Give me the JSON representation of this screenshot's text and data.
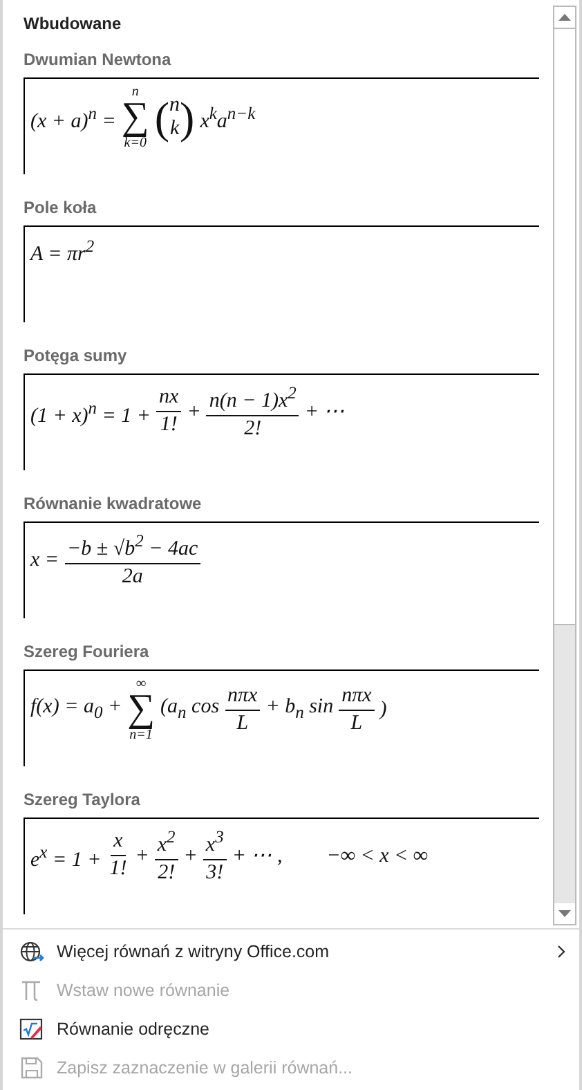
{
  "gallery": {
    "heading": "Wbudowane",
    "equations": [
      {
        "title": "Dwumian Newtona",
        "parts": [
          {
            "kind": "t",
            "text": "(x + a)$^{n}$ ="
          },
          {
            "kind": "sum",
            "symbol": "∑",
            "top": "n",
            "bottom": "k=0"
          },
          {
            "kind": "binom",
            "open": "(",
            "top": "n",
            "bottom": "k",
            "close": ")"
          },
          {
            "kind": "t",
            "text": "x$^{k}$a$^{n−k}$"
          }
        ]
      },
      {
        "title": "Pole koła",
        "parts": [
          {
            "kind": "t",
            "text": "A = πr$^{2}$"
          }
        ]
      },
      {
        "title": "Potęga sumy",
        "parts": [
          {
            "kind": "t",
            "text": "(1 + x)$^{n}$ = 1 +"
          },
          {
            "kind": "frac",
            "top": "nx",
            "bottom": "1!"
          },
          {
            "kind": "t",
            "text": "+"
          },
          {
            "kind": "frac",
            "top": "n(n − 1)x$^{2}$",
            "bottom": "2!"
          },
          {
            "kind": "t",
            "text": "+ ⋯"
          }
        ]
      },
      {
        "title": "Równanie kwadratowe",
        "parts": [
          {
            "kind": "t",
            "text": "x ="
          },
          {
            "kind": "frac",
            "top": "−b ± √b$^{2}$ − 4ac",
            "bottom": "2a"
          }
        ]
      },
      {
        "title": "Szereg Fouriera",
        "parts": [
          {
            "kind": "t",
            "text": "f(x) = a$_{0}$ +"
          },
          {
            "kind": "sum",
            "symbol": "∑",
            "top": "∞",
            "bottom": "n=1"
          },
          {
            "kind": "t",
            "text": "(a$_{n}$ cos"
          },
          {
            "kind": "frac",
            "top": "nπx",
            "bottom": "L"
          },
          {
            "kind": "t",
            "text": "+ b$_{n}$ sin"
          },
          {
            "kind": "frac",
            "top": "nπx",
            "bottom": "L"
          },
          {
            "kind": "t",
            "text": ")"
          }
        ]
      },
      {
        "title": "Szereg Taylora",
        "parts": [
          {
            "kind": "t",
            "text": "e$^{x}$ = 1 +"
          },
          {
            "kind": "frac",
            "top": "x",
            "bottom": "1!"
          },
          {
            "kind": "t",
            "text": "+"
          },
          {
            "kind": "frac",
            "top": "x$^{2}$",
            "bottom": "2!"
          },
          {
            "kind": "t",
            "text": "+"
          },
          {
            "kind": "frac",
            "top": "x$^{3}$",
            "bottom": "3!"
          },
          {
            "kind": "t",
            "text": "+ ⋯ ,"
          },
          {
            "kind": "aside",
            "text": "−∞ < x < ∞"
          }
        ]
      }
    ]
  },
  "menu": [
    {
      "kind": "globe",
      "label": "Więcej równań z witryny Office.com",
      "disabled": false,
      "submenu": true
    },
    {
      "kind": "pi",
      "label": "Wstaw nowe równanie",
      "disabled": true,
      "submenu": false
    },
    {
      "kind": "ink",
      "label": "Równanie odręczne",
      "disabled": false,
      "submenu": false
    },
    {
      "kind": "save",
      "label": "Zapisz zaznaczenie w galerii równań...",
      "disabled": true,
      "submenu": false
    }
  ]
}
